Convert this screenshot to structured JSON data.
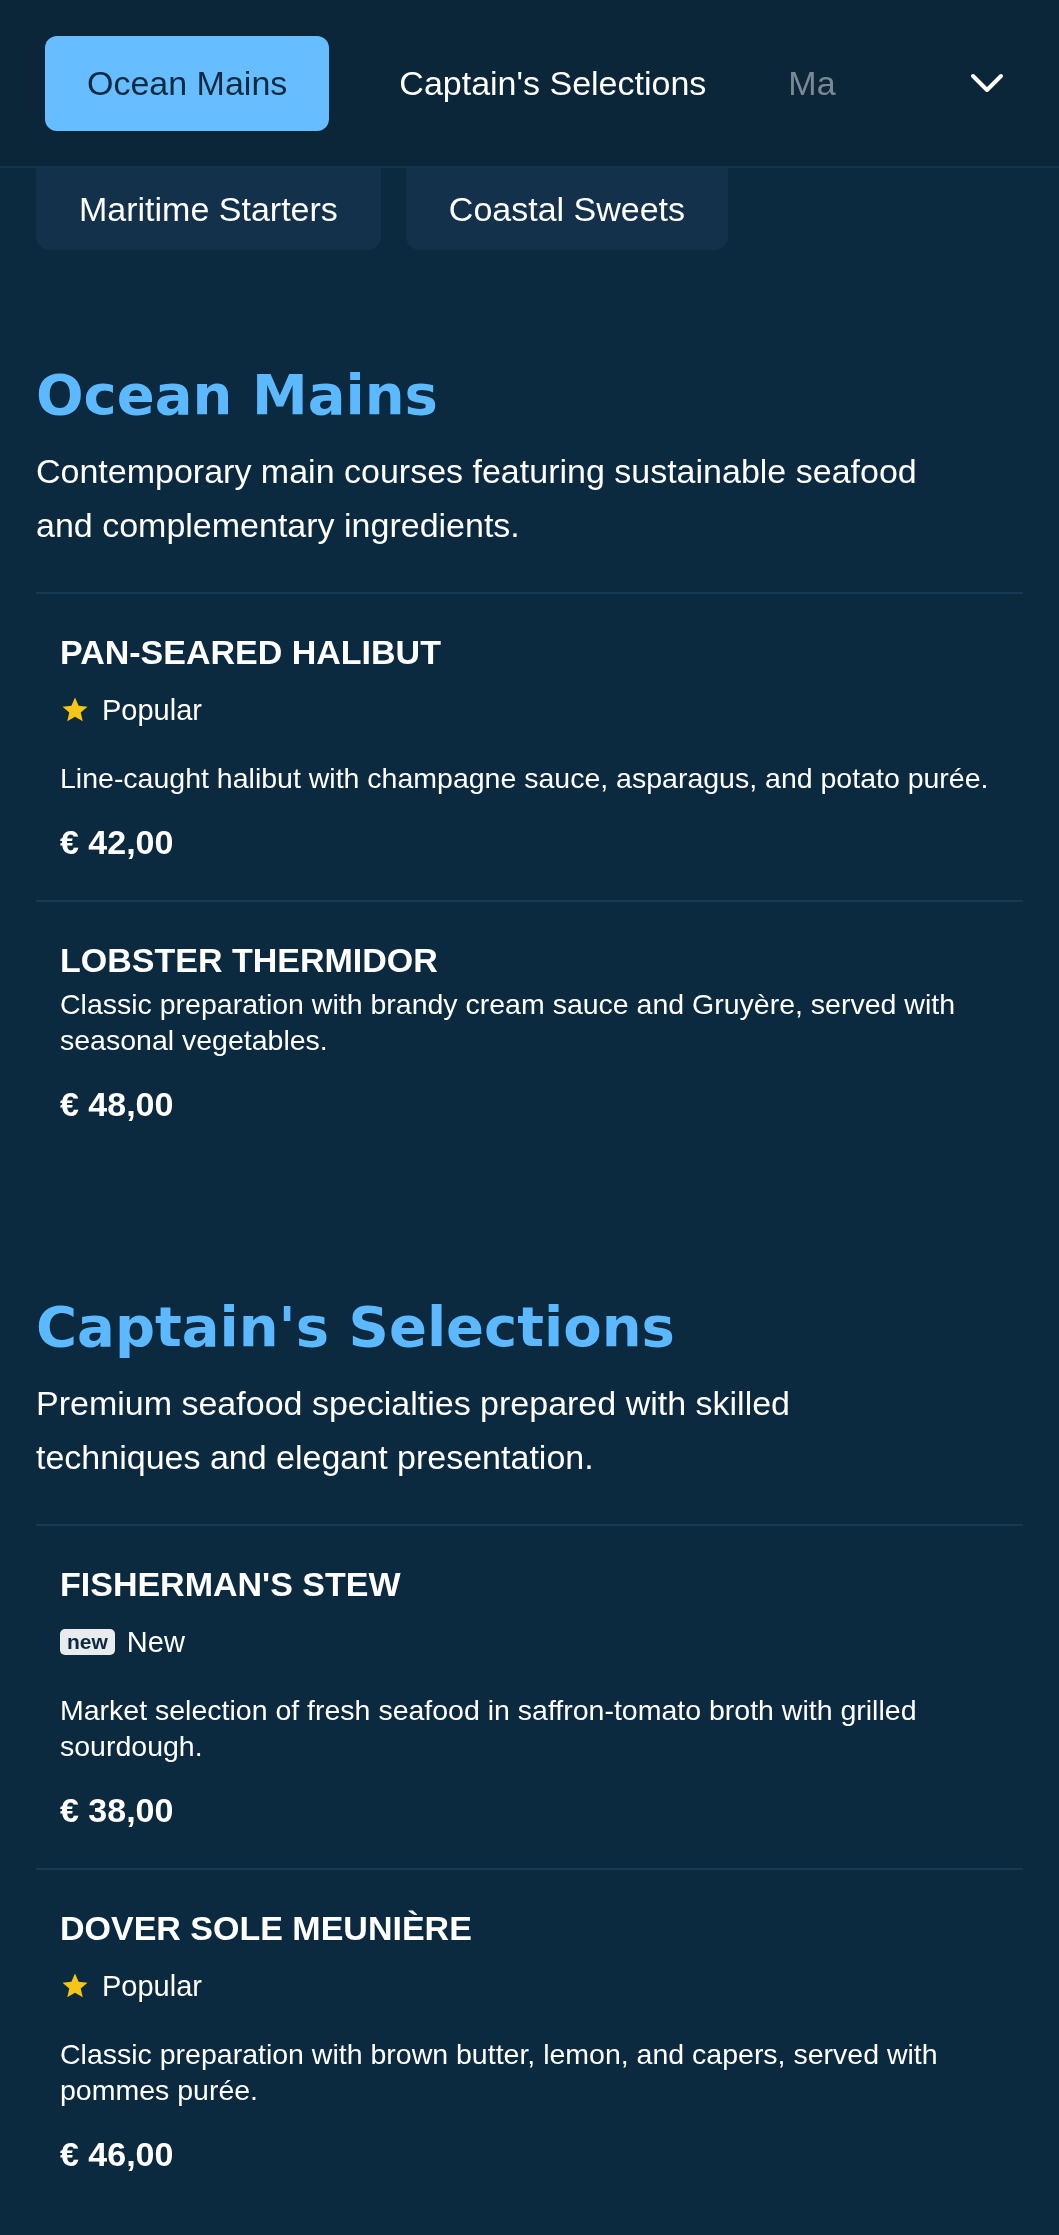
{
  "tabs": [
    {
      "label": "Ocean Mains",
      "selected": true
    },
    {
      "label": "Captain's Selections",
      "selected": false
    },
    {
      "label": "Ma",
      "selected": false
    }
  ],
  "chips": [
    "Maritime Starters",
    "Coastal Sweets"
  ],
  "sections": [
    {
      "title": "Ocean Mains",
      "description": "Contemporary main courses featuring sustainable seafood and complementary ingredients.",
      "items": [
        {
          "name": "PAN-SEARED HALIBUT",
          "tag": {
            "kind": "popular",
            "label": "Popular"
          },
          "description": "Line-caught halibut with champagne sauce, asparagus, and potato purée.",
          "price": "€ 42,00"
        },
        {
          "name": "LOBSTER THERMIDOR",
          "description": "Classic preparation with brandy cream sauce and Gruyère, served with seasonal vegetables.",
          "price": "€ 48,00"
        }
      ]
    },
    {
      "title": "Captain's Selections",
      "description": "Premium seafood specialties prepared with skilled techniques and elegant presentation.",
      "items": [
        {
          "name": "FISHERMAN'S STEW",
          "tag": {
            "kind": "new",
            "badge": "new",
            "label": "New"
          },
          "description": "Market selection of fresh seafood in saffron-tomato broth with grilled sourdough.",
          "price": "€ 38,00"
        },
        {
          "name": "DOVER SOLE MEUNIÈRE",
          "tag": {
            "kind": "popular",
            "label": "Popular"
          },
          "description": "Classic preparation with brown butter, lemon, and capers, served with pommes purée.",
          "price": "€ 46,00"
        }
      ]
    }
  ]
}
